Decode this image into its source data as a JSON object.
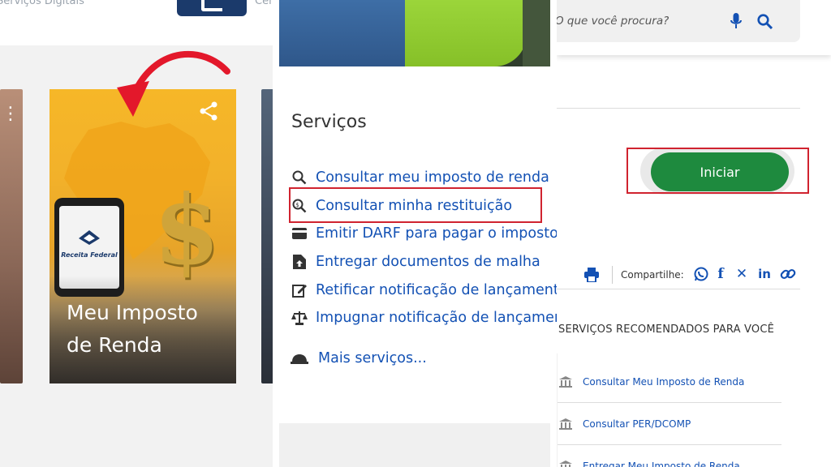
{
  "left": {
    "topbar": {
      "section_label": "Serviços Digitais",
      "partial_label": "Cen"
    },
    "card": {
      "title_line1": "Meu Imposto",
      "title_line2": "de Renda",
      "phone_brand": "Receita Federal"
    }
  },
  "middle": {
    "section_title": "Serviços",
    "services": [
      {
        "icon": "search-icon",
        "label": "Consultar meu imposto de renda"
      },
      {
        "icon": "search-money-icon",
        "label": "Consultar minha restituição"
      },
      {
        "icon": "credit-card-icon",
        "label": "Emitir DARF para pagar o imposto"
      },
      {
        "icon": "upload-doc-icon",
        "label": "Entregar documentos de malha"
      },
      {
        "icon": "edit-icon",
        "label": "Retificar notificação de lançamento"
      },
      {
        "icon": "scale-icon",
        "label": "Impugnar notificação de lançamento"
      }
    ],
    "more_label": "Mais serviços..."
  },
  "right": {
    "search": {
      "placeholder": "O que você procura?"
    },
    "start_button": "Iniciar",
    "share_label": "Compartilhe:",
    "recommended_title": "SERVIÇOS RECOMENDADOS PARA VOCÊ",
    "recommended": [
      {
        "label": "Consultar Meu Imposto de Renda"
      },
      {
        "label": "Consultar PER/DCOMP"
      },
      {
        "label": "Entregar Meu Imposto de Renda"
      }
    ]
  },
  "colors": {
    "link": "#1351b4",
    "highlight": "#d0232f",
    "button": "#1e8a3e"
  }
}
